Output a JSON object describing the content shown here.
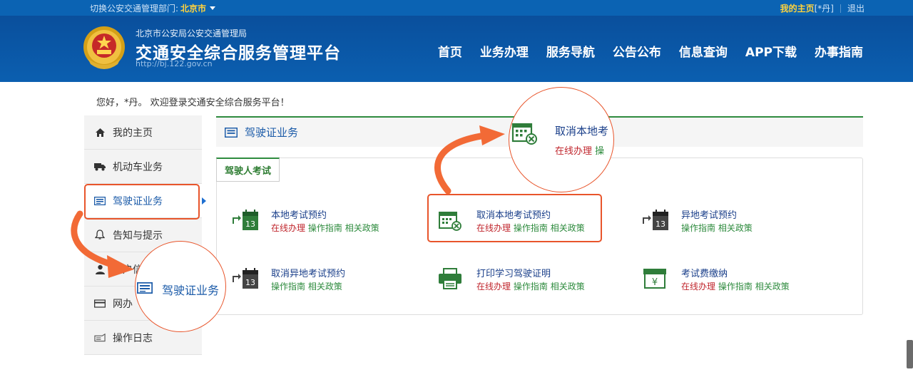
{
  "topbar": {
    "switch_label": "切换公安交通管理部门:",
    "city": "北京市",
    "my_home": "我的主页",
    "user_tag": "[*丹]",
    "logout": "退出"
  },
  "header": {
    "subtitle": "北京市公安局公安交通管理局",
    "title": "交通安全综合服务管理平台",
    "url": "http://bj.122.gov.cn",
    "nav": [
      "首页",
      "业务办理",
      "服务导航",
      "公告公布",
      "信息查询",
      "APP下载",
      "办事指南"
    ]
  },
  "greeting": "您好，*丹。 欢迎登录交通安全综合服务平台！",
  "sidebar": {
    "items": [
      {
        "label": "我的主页",
        "icon": "home-icon"
      },
      {
        "label": "机动车业务",
        "icon": "truck-icon"
      },
      {
        "label": "驾驶证业务",
        "icon": "license-card-icon"
      },
      {
        "label": "告知与提示",
        "icon": "bell-icon"
      },
      {
        "label": "用户信息",
        "icon": "user-icon"
      },
      {
        "label": "网办",
        "icon": "card-icon"
      },
      {
        "label": "操作日志",
        "icon": "log-icon"
      }
    ]
  },
  "content": {
    "section_title": "驾驶证业务",
    "tab_label": "驾驶人考试",
    "services": [
      {
        "name": "本地考试预约",
        "links": [
          {
            "text": "在线办理",
            "tone": "red"
          },
          {
            "text": "操作指南",
            "tone": "green"
          },
          {
            "text": "相关政策",
            "tone": "green"
          }
        ],
        "icon": "calendar-13-icon"
      },
      {
        "name": "取消本地考试预约",
        "links": [
          {
            "text": "在线办理",
            "tone": "red"
          },
          {
            "text": "操作指南",
            "tone": "green"
          },
          {
            "text": "相关政策",
            "tone": "green"
          }
        ],
        "icon": "calendar-cancel-icon"
      },
      {
        "name": "异地考试预约",
        "links": [
          {
            "text": "操作指南",
            "tone": "green"
          },
          {
            "text": "相关政策",
            "tone": "green"
          }
        ],
        "icon": "calendar-13-icon"
      },
      {
        "name": "取消异地考试预约",
        "links": [
          {
            "text": "操作指南",
            "tone": "green"
          },
          {
            "text": "相关政策",
            "tone": "green"
          }
        ],
        "icon": "calendar-13-icon"
      },
      {
        "name": "打印学习驾驶证明",
        "links": [
          {
            "text": "在线办理",
            "tone": "red"
          },
          {
            "text": "操作指南",
            "tone": "green"
          },
          {
            "text": "相关政策",
            "tone": "green"
          }
        ],
        "icon": "printer-icon"
      },
      {
        "name": "考试费缴纳",
        "links": [
          {
            "text": "在线办理",
            "tone": "red"
          },
          {
            "text": "操作指南",
            "tone": "green"
          },
          {
            "text": "相关政策",
            "tone": "green"
          }
        ],
        "icon": "payment-yen-icon"
      }
    ]
  },
  "callouts": {
    "service_zoom": {
      "name": "取消本地考",
      "link1": "在线办理",
      "link2": "操"
    },
    "sidebar_zoom": {
      "name": "驾驶证业务"
    }
  },
  "colors": {
    "accent": "#e8552b",
    "brand_blue": "#0b5fb0",
    "green": "#2e8b3e",
    "red": "#c0262d"
  }
}
